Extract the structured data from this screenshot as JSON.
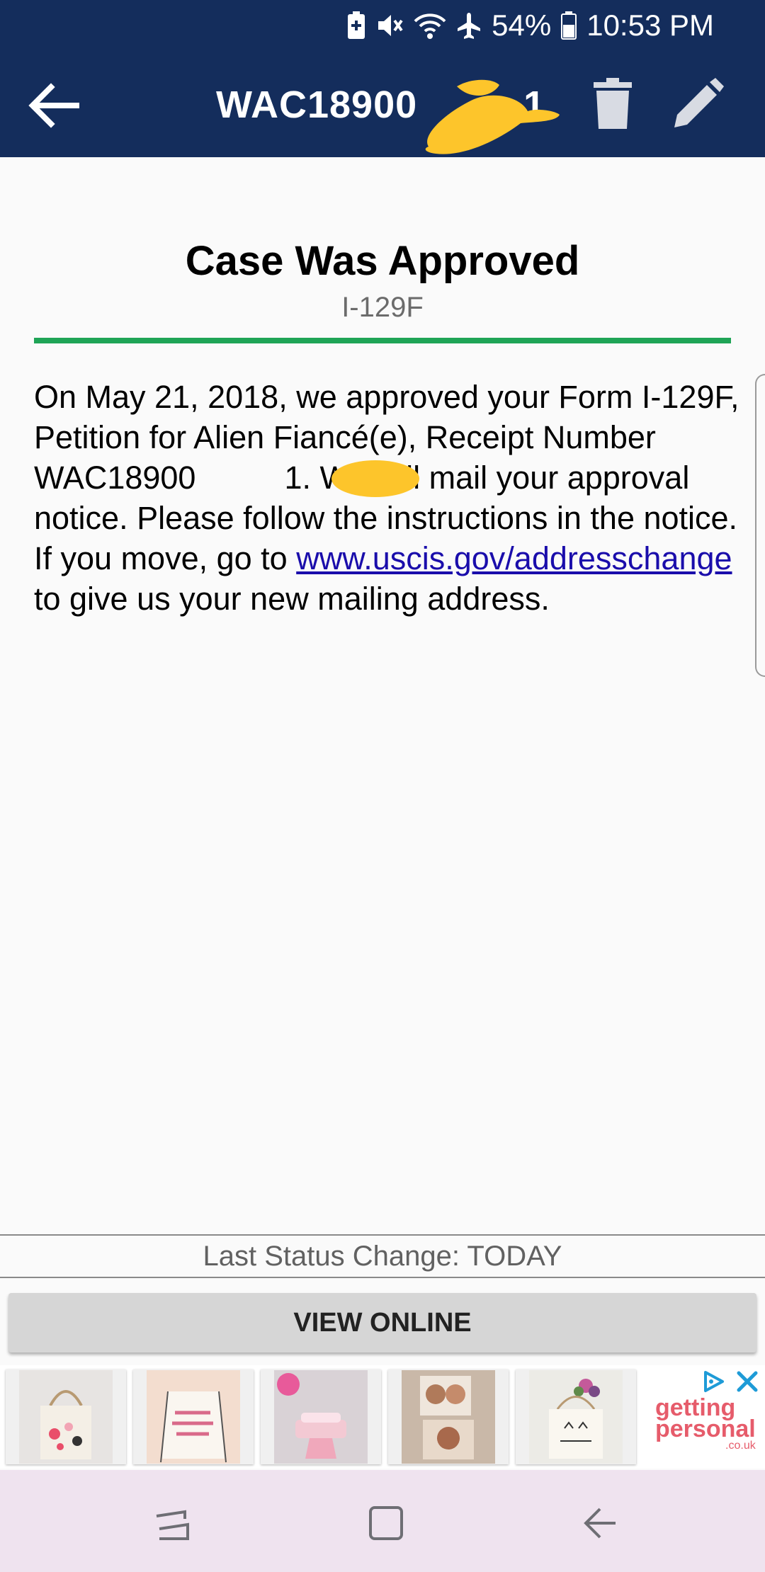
{
  "status_bar": {
    "battery": "54%",
    "time": "10:53 PM",
    "icons": [
      "battery-saver-icon",
      "vibrate-icon",
      "wifi-icon",
      "airplane-icon",
      "battery-icon"
    ]
  },
  "app_bar": {
    "title": "WAC18900",
    "title_suffix": "1",
    "back_icon": "arrow-back-icon",
    "delete_icon": "trash-icon",
    "edit_icon": "pencil-icon"
  },
  "case": {
    "status": "Case Was Approved",
    "form": "I-129F",
    "body_pre": "On May 21, 2018, we approved your Form I-129F, Petition for Alien Fiancé(e), Receipt Number WAC18900",
    "body_mid": "1. We will mail your approval notice. Please follow the instructions in the notice. If you move, go to ",
    "link": "www.uscis.gov/addresschange",
    "body_post": " to give us your new mailing address."
  },
  "footer": {
    "last_status": "Last Status Change: TODAY",
    "view_online": "VIEW ONLINE"
  },
  "ad": {
    "brand_line1": "getting",
    "brand_line2": "personal",
    "brand_domain": ".co.uk"
  },
  "colors": {
    "header_bg": "#142d5c",
    "accent_green": "#1fa456",
    "link": "#1a0dab",
    "redaction": "#fdc52b",
    "nav_bg": "#efe3ef"
  }
}
